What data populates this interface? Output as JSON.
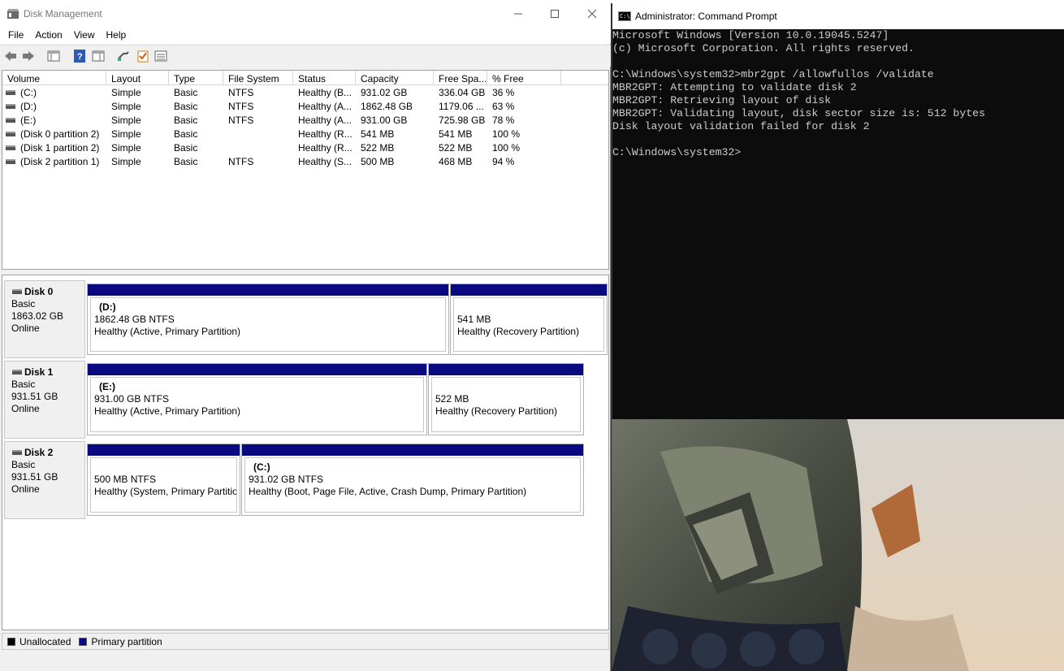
{
  "disk_management": {
    "title": "Disk Management",
    "menu": [
      "File",
      "Action",
      "View",
      "Help"
    ],
    "columns": [
      "Volume",
      "Layout",
      "Type",
      "File System",
      "Status",
      "Capacity",
      "Free Spa...",
      "% Free"
    ],
    "volumes": [
      {
        "volume": "(C:)",
        "layout": "Simple",
        "type": "Basic",
        "fs": "NTFS",
        "status": "Healthy (B...",
        "capacity": "931.02 GB",
        "free": "336.04 GB",
        "pct": "36 %"
      },
      {
        "volume": "(D:)",
        "layout": "Simple",
        "type": "Basic",
        "fs": "NTFS",
        "status": "Healthy (A...",
        "capacity": "1862.48 GB",
        "free": "1179.06 ...",
        "pct": "63 %"
      },
      {
        "volume": "(E:)",
        "layout": "Simple",
        "type": "Basic",
        "fs": "NTFS",
        "status": "Healthy (A...",
        "capacity": "931.00 GB",
        "free": "725.98 GB",
        "pct": "78 %"
      },
      {
        "volume": "(Disk 0 partition 2)",
        "layout": "Simple",
        "type": "Basic",
        "fs": "",
        "status": "Healthy (R...",
        "capacity": "541 MB",
        "free": "541 MB",
        "pct": "100 %"
      },
      {
        "volume": "(Disk 1 partition 2)",
        "layout": "Simple",
        "type": "Basic",
        "fs": "",
        "status": "Healthy (R...",
        "capacity": "522 MB",
        "free": "522 MB",
        "pct": "100 %"
      },
      {
        "volume": "(Disk 2 partition 1)",
        "layout": "Simple",
        "type": "Basic",
        "fs": "NTFS",
        "status": "Healthy (S...",
        "capacity": "500 MB",
        "free": "468 MB",
        "pct": "94 %"
      }
    ],
    "disks": [
      {
        "name": "Disk 0",
        "type": "Basic",
        "size": "1863.02 GB",
        "state": "Online",
        "partitions": [
          {
            "label": "(D:)",
            "size": "1862.48 GB NTFS",
            "status": "Healthy (Active, Primary Partition)"
          },
          {
            "label": "",
            "size": "541 MB",
            "status": "Healthy (Recovery Partition)"
          }
        ]
      },
      {
        "name": "Disk 1",
        "type": "Basic",
        "size": "931.51 GB",
        "state": "Online",
        "partitions": [
          {
            "label": "(E:)",
            "size": "931.00 GB NTFS",
            "status": "Healthy (Active, Primary Partition)"
          },
          {
            "label": "",
            "size": "522 MB",
            "status": "Healthy (Recovery Partition)"
          }
        ]
      },
      {
        "name": "Disk 2",
        "type": "Basic",
        "size": "931.51 GB",
        "state": "Online",
        "partitions": [
          {
            "label": "",
            "size": "500 MB NTFS",
            "status": "Healthy (System, Primary Partitio"
          },
          {
            "label": "(C:)",
            "size": "931.02 GB NTFS",
            "status": "Healthy (Boot, Page File, Active, Crash Dump, Primary Partition)"
          }
        ]
      }
    ],
    "legend": [
      {
        "label": "Unallocated",
        "color": "#000000"
      },
      {
        "label": "Primary partition",
        "color": "#0a0a80"
      }
    ]
  },
  "command_prompt": {
    "title": "Administrator: Command Prompt",
    "icon_text": "C:\\",
    "lines": [
      "Microsoft Windows [Version 10.0.19045.5247]",
      "(c) Microsoft Corporation. All rights reserved.",
      "",
      "C:\\Windows\\system32>mbr2gpt /allowfullos /validate",
      "MBR2GPT: Attempting to validate disk 2",
      "MBR2GPT: Retrieving layout of disk",
      "MBR2GPT: Validating layout, disk sector size is: 512 bytes",
      "Disk layout validation failed for disk 2",
      "",
      "C:\\Windows\\system32>"
    ]
  }
}
